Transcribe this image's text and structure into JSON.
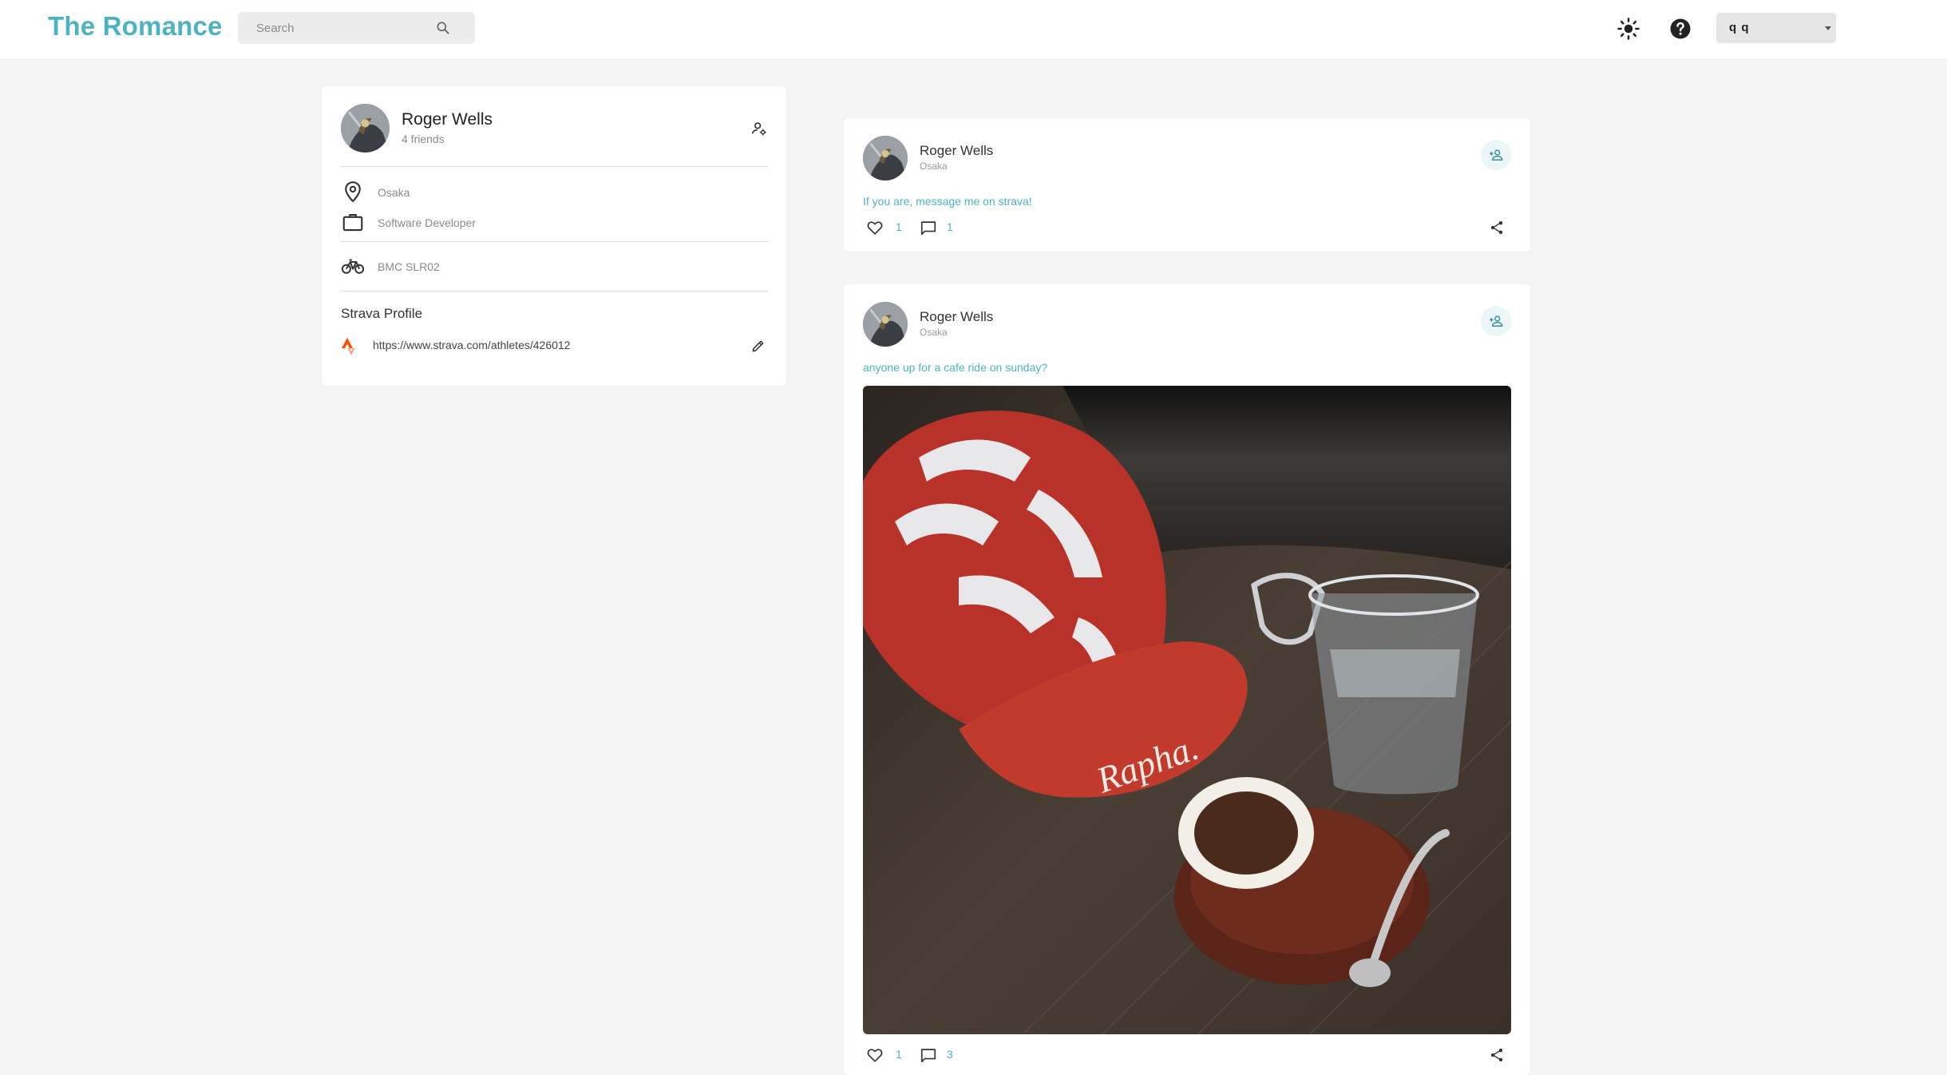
{
  "header": {
    "logo": "The Romance",
    "search_placeholder": "Search",
    "icons": {
      "search": "search-icon",
      "theme": "sun-icon",
      "help": "help-icon"
    },
    "user_select": {
      "selected": "q q"
    }
  },
  "profile": {
    "name": "Roger Wells",
    "friends": "4 friends",
    "location": "Osaka",
    "job": "Software Developer",
    "bike": "BMC SLR02",
    "strava_title": "Strava Profile",
    "strava_url": "https://www.strava.com/athletes/426012"
  },
  "posts": [
    {
      "author": "Roger Wells",
      "location": "Osaka",
      "text": "If you are, message me on strava!",
      "likes": "1",
      "comments": "1"
    },
    {
      "author": "Roger Wells",
      "location": "Osaka",
      "text": "anyone up for a cafe ride on sunday?",
      "likes": "1",
      "comments": "3",
      "image": "photo of a cycling helmet, cap, water glass and espresso cup on a wooden table"
    }
  ],
  "colors": {
    "accent": "#4cb3c2",
    "background": "#f5f5f5",
    "card": "#ffffff"
  }
}
